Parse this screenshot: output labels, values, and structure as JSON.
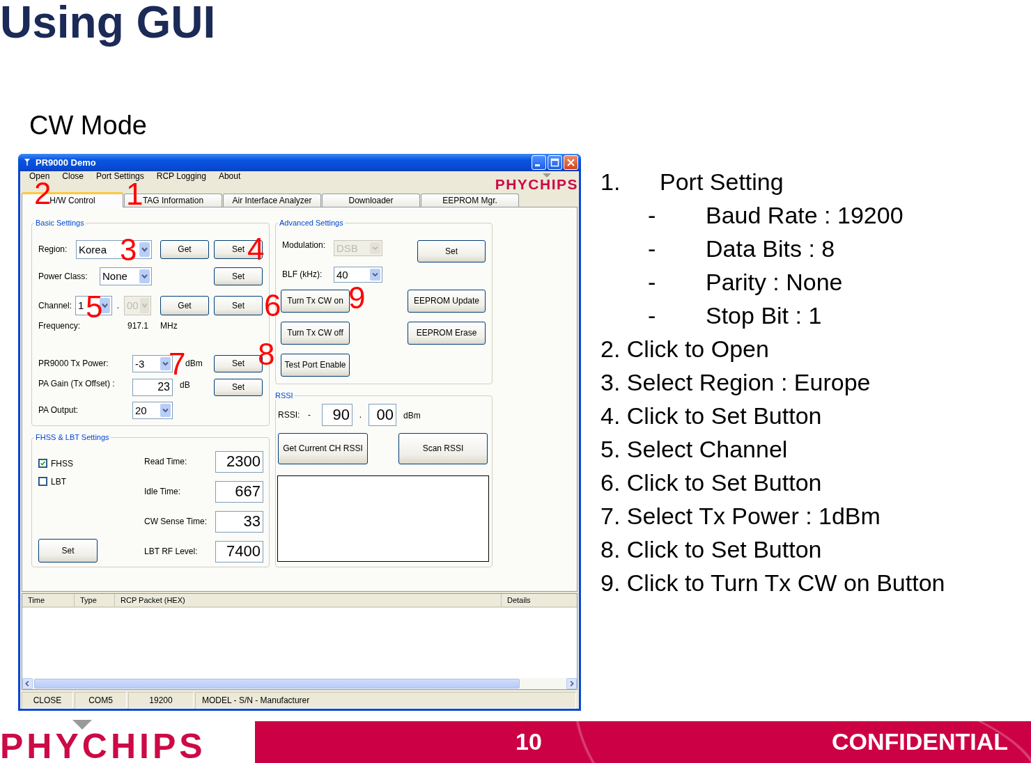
{
  "slide": {
    "title": "Using GUI",
    "subtitle": "CW Mode",
    "logo": "PHYCHIPS",
    "page_number": "10",
    "footer_label": "CONFIDENTIAL"
  },
  "window": {
    "title": "PR9000 Demo",
    "logo": "PHYCHIPS",
    "menu": [
      {
        "label": "Open",
        "annotation": "2"
      },
      {
        "label": "Close"
      },
      {
        "label": "Port Settings",
        "annotation": "1"
      },
      {
        "label": "RCP Logging"
      },
      {
        "label": "About"
      }
    ],
    "tabs": [
      {
        "label": "H/W Control",
        "selected": true
      },
      {
        "label": "TAG Information",
        "selected": false
      },
      {
        "label": "Air Interface Analyzer",
        "selected": false
      },
      {
        "label": "Downloader",
        "selected": false
      },
      {
        "label": "EEPROM Mgr.",
        "selected": false
      }
    ],
    "basic_settings": {
      "title": "Basic Settings",
      "region": {
        "label": "Region:",
        "value": "Korea",
        "annotation": "3",
        "get": "Get",
        "set": "Set",
        "set_annotation": "4"
      },
      "power_class": {
        "label": "Power Class:",
        "value": "None",
        "set": "Set"
      },
      "channel": {
        "label": "Channel:",
        "value": "1",
        "annotation": "5",
        "separator": ".",
        "sub_value": "00",
        "sub_disabled": true,
        "get": "Get",
        "set": "Set",
        "set_annotation": "6"
      },
      "frequency": {
        "label": "Frequency:",
        "value": "917.1",
        "unit": "MHz"
      },
      "tx_power": {
        "label": "PR9000 Tx Power:",
        "value": "-3",
        "annotation": "7",
        "unit": "dBm",
        "set": "Set",
        "set_annotation": "8"
      },
      "pa_gain": {
        "label": "PA Gain (Tx Offset) :",
        "value": "23",
        "unit": "dB",
        "set": "Set"
      },
      "pa_output": {
        "label": "PA Output:",
        "value": "20"
      }
    },
    "advanced_settings": {
      "title": "Advanced Settings",
      "modulation": {
        "label": "Modulation:",
        "value": "DSB",
        "disabled": true,
        "set": "Set"
      },
      "blf": {
        "label": "BLF (kHz):",
        "value": "40",
        "disabled": false
      },
      "buttons": [
        {
          "label": "Turn Tx CW on",
          "annotation": "9"
        },
        {
          "label": "EEPROM Update"
        },
        {
          "label": "Turn Tx CW off"
        },
        {
          "label": "EEPROM Erase"
        },
        {
          "label": "Test Port Enable"
        }
      ]
    },
    "rssi": {
      "title": "RSSI",
      "label": "RSSI:",
      "sign": "-",
      "integer": "90",
      "separator": ".",
      "fraction": "00",
      "unit": "dBm",
      "buttons": [
        {
          "label": "Get Current CH RSSI"
        },
        {
          "label": "Scan RSSI"
        }
      ]
    },
    "fhss_lbt": {
      "title": "FHSS & LBT Settings",
      "options": [
        {
          "label": "FHSS",
          "checked": true
        },
        {
          "label": "LBT",
          "checked": false
        }
      ],
      "set": "Set",
      "fields": [
        {
          "label": "Read Time:",
          "value": "2300"
        },
        {
          "label": "Idle Time:",
          "value": "667"
        },
        {
          "label": "CW Sense Time:",
          "value": "33"
        },
        {
          "label": "LBT RF Level:",
          "value": "7400"
        }
      ]
    },
    "log": {
      "columns": [
        "Time",
        "Type",
        "RCP Packet (HEX)",
        "Details"
      ]
    },
    "status_bar": [
      "CLOSE",
      "COM5",
      "19200",
      "MODEL - S/N - Manufacturer"
    ]
  },
  "steps": [
    {
      "number": "1.",
      "text": "Port Setting",
      "details": [
        {
          "bullet": "-",
          "text": "Baud Rate : 19200"
        },
        {
          "bullet": "-",
          "text": "Data Bits : 8"
        },
        {
          "bullet": "-",
          "text": "Parity : None"
        },
        {
          "bullet": "-",
          "text": "Stop Bit : 1"
        }
      ]
    },
    {
      "text": "2. Click to Open"
    },
    {
      "text": "3. Select Region : Europe"
    },
    {
      "text": "4. Click to Set Button"
    },
    {
      "text": "5. Select Channel"
    },
    {
      "text": "6. Click to Set Button"
    },
    {
      "text": "7. Select Tx Power : 1dBm"
    },
    {
      "text": "8. Click to Set Button"
    },
    {
      "text": "9. Click to Turn Tx CW on Button"
    }
  ]
}
